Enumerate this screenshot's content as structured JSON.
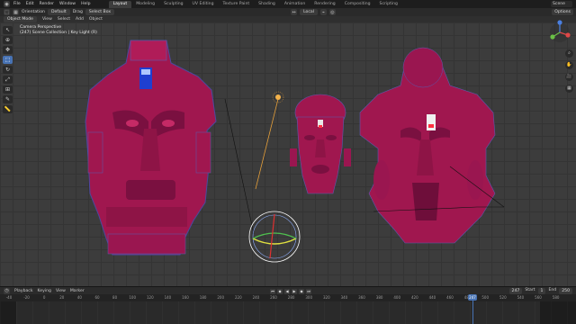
{
  "topbar": {
    "menus": [
      "File",
      "Edit",
      "Render",
      "Window",
      "Help"
    ],
    "tabs": [
      "Layout",
      "Modeling",
      "Sculpting",
      "UV Editing",
      "Texture Paint",
      "Shading",
      "Animation",
      "Rendering",
      "Compositing",
      "Scripting"
    ],
    "active_tab": "Layout",
    "scene": "Scene"
  },
  "toolbar": {
    "orientation_label": "Orientation",
    "orientation_value": "Default",
    "drag_label": "Drag",
    "drag_value": "Select Box",
    "pivot_value": "Local",
    "options_label": "Options"
  },
  "header": {
    "mode": "Object Mode",
    "menus": [
      "View",
      "Select",
      "Add",
      "Object"
    ]
  },
  "viewport": {
    "camera_label": "Camera Perspective",
    "collection_label": "(247) Scene Collection | Key Light (R)"
  },
  "timeline": {
    "menus": [
      "Playback",
      "Keying",
      "View",
      "Marker"
    ],
    "current_frame": "247",
    "start_label": "Start",
    "start_value": "1",
    "end_label": "End",
    "end_value": "250",
    "ticks": [
      "-40",
      "-20",
      "0",
      "20",
      "40",
      "60",
      "80",
      "100",
      "120",
      "140",
      "160",
      "180",
      "200",
      "220",
      "240",
      "260",
      "280",
      "300",
      "320",
      "340",
      "360",
      "380",
      "400",
      "420",
      "440",
      "460",
      "480",
      "500",
      "520",
      "540",
      "560",
      "580"
    ],
    "tick_positions_note": ""
  },
  "colors": {
    "accent": "#4772b3",
    "mask_fill": "#a0174f",
    "mask_wire": "#5a5aa8",
    "light_line": "#e8a13a"
  }
}
